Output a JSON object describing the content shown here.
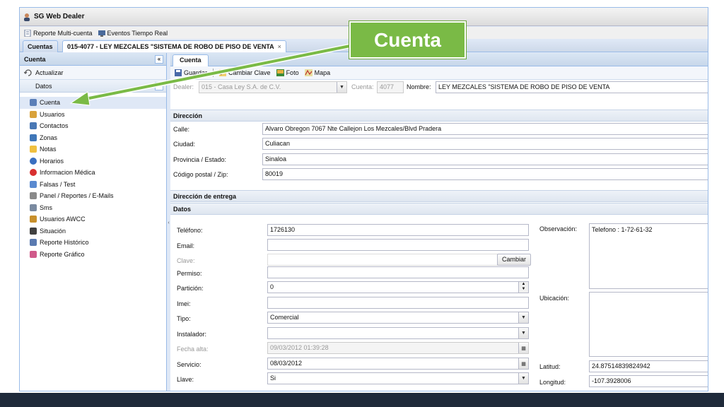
{
  "app": {
    "title": "SG Web Dealer"
  },
  "toolbar": {
    "items": [
      "Reporte Multi-cuenta",
      "Eventos Tiempo Real"
    ]
  },
  "tabs": {
    "cuentas": "Cuentas",
    "account": "015-4077 - LEY MEZCALES \"SISTEMA DE ROBO DE PISO DE VENTA",
    "close": "×"
  },
  "sidebar": {
    "title": "Cuenta",
    "collapse": "«",
    "refresh": "Actualizar",
    "group": "Datos",
    "group_toggle": "−",
    "items": [
      {
        "label": "Cuenta",
        "icon": "account-icon",
        "color": "#5b7fb8"
      },
      {
        "label": "Usuarios",
        "icon": "users-icon",
        "color": "#d9a23b"
      },
      {
        "label": "Contactos",
        "icon": "contacts-icon",
        "color": "#4a78b5"
      },
      {
        "label": "Zonas",
        "icon": "zones-icon",
        "color": "#3f76b8"
      },
      {
        "label": "Notas",
        "icon": "notes-icon",
        "color": "#f0c040"
      },
      {
        "label": "Horarios",
        "icon": "clock-icon",
        "color": "#3a6fc0"
      },
      {
        "label": "Informacion Médica",
        "icon": "medical-icon",
        "color": "#d83030"
      },
      {
        "label": "Falsas / Test",
        "icon": "wrench-icon",
        "color": "#5a8ad0"
      },
      {
        "label": "Panel / Reportes / E-Mails",
        "icon": "panel-icon",
        "color": "#8a8a8a"
      },
      {
        "label": "Sms",
        "icon": "sms-icon",
        "color": "#7a8aa0"
      },
      {
        "label": "Usuarios AWCC",
        "icon": "awcc-users-icon",
        "color": "#c8902c"
      },
      {
        "label": "Situación",
        "icon": "situation-icon",
        "color": "#404040"
      },
      {
        "label": "Reporte Histórico",
        "icon": "history-report-icon",
        "color": "#5a7ab0"
      },
      {
        "label": "Reporte Gráfico",
        "icon": "chart-report-icon",
        "color": "#d05a8a"
      }
    ]
  },
  "main": {
    "tab": "Cuenta",
    "actions": {
      "save": "Guardar",
      "change_key": "Cambiar Clave",
      "photo": "Foto",
      "map": "Mapa"
    },
    "dealer_label": "Dealer:",
    "dealer_value": "015 - Casa Ley S.A. de C.V.",
    "account_label": "Cuenta:",
    "account_value": "4077",
    "name_label": "Nombre:",
    "name_value": "LEY MEZCALES \"SISTEMA DE ROBO DE PISO DE VENTA",
    "address": {
      "title": "Dirección",
      "street_label": "Calle:",
      "street": "Alvaro Obregon 7067 Nte Callejon Los Mezcales/Blvd Pradera",
      "city_label": "Ciudad:",
      "city": "Culiacan",
      "state_label": "Provincia / Estado:",
      "state": "Sinaloa",
      "zip_label": "Código postal / Zip:",
      "zip": "80019"
    },
    "delivery_title": "Dirección de entrega",
    "data_title": "Datos",
    "data": {
      "phone_label": "Teléfono:",
      "phone": "1726130",
      "email_label": "Email:",
      "email": "",
      "key_label": "Clave:",
      "key": "",
      "change_btn": "Cambiar",
      "permit_label": "Permiso:",
      "permit": "",
      "partition_label": "Partición:",
      "partition": "0",
      "imei_label": "Imei:",
      "imei": "",
      "type_label": "Tipo:",
      "type": "Comercial",
      "installer_label": "Instalador:",
      "installer": "",
      "created_label": "Fecha alta:",
      "created": "09/03/2012 01:39:28",
      "service_label": "Servicio:",
      "service": "08/03/2012",
      "key2_label": "Llave:",
      "key2": "Si",
      "obs_label": "Observación:",
      "obs": "Telefono : 1-72-61-32",
      "location_label": "Ubicación:",
      "location": "",
      "lat_label": "Latitud:",
      "lat": "24.87514839824942",
      "lon_label": "Longitud:",
      "lon": "-107.3928006"
    }
  },
  "callout": {
    "text": "Cuenta",
    "color": "#7aba46"
  }
}
